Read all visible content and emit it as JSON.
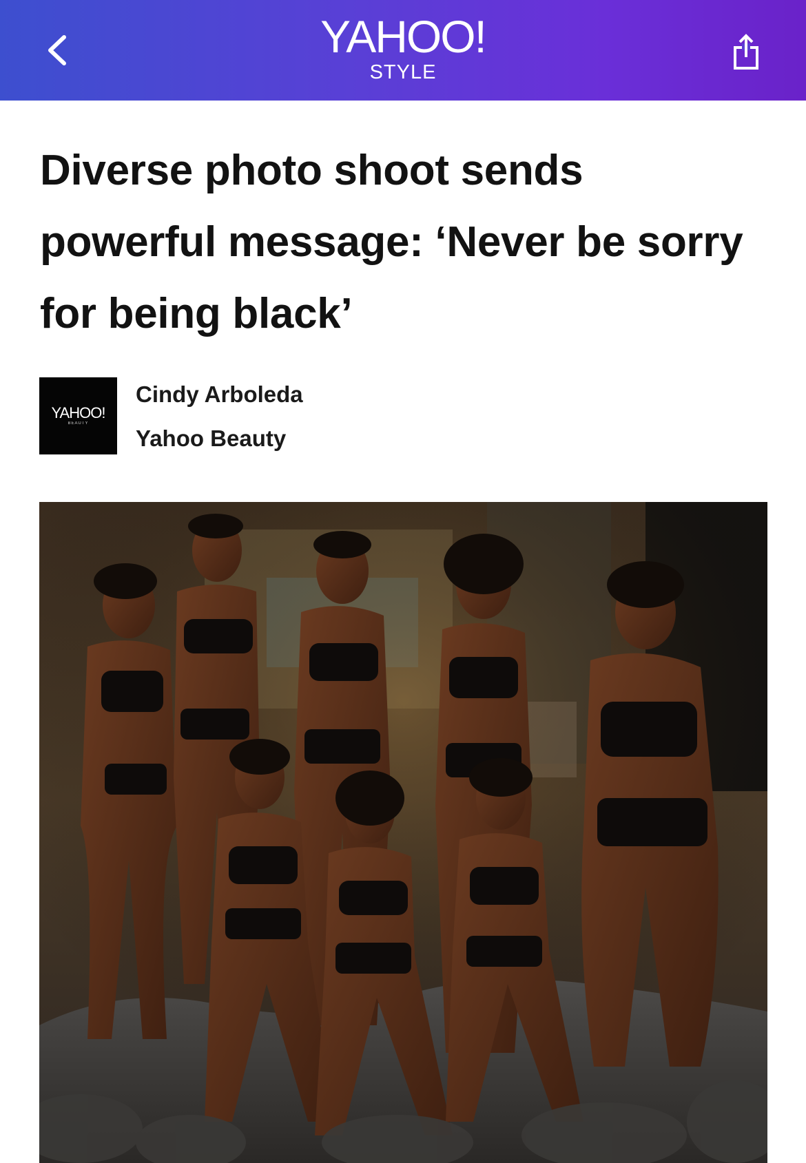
{
  "header": {
    "brand_logo": "YAHOO!",
    "brand_section": "STYLE",
    "back_icon": "chevron-left-icon",
    "share_icon": "share-icon",
    "gradient_colors": [
      "#3d4fcf",
      "#6a22c9"
    ]
  },
  "article": {
    "headline": "Diverse photo shoot sends powerful message: ‘Never be sorry for being black’",
    "author_logo_text": "YAHOO!",
    "author_logo_subtext": "BEAUTY",
    "author_name": "Cindy Arboleda",
    "author_source": "Yahoo Beauty"
  },
  "hero_image": {
    "description_icon": "group-photo-image"
  }
}
